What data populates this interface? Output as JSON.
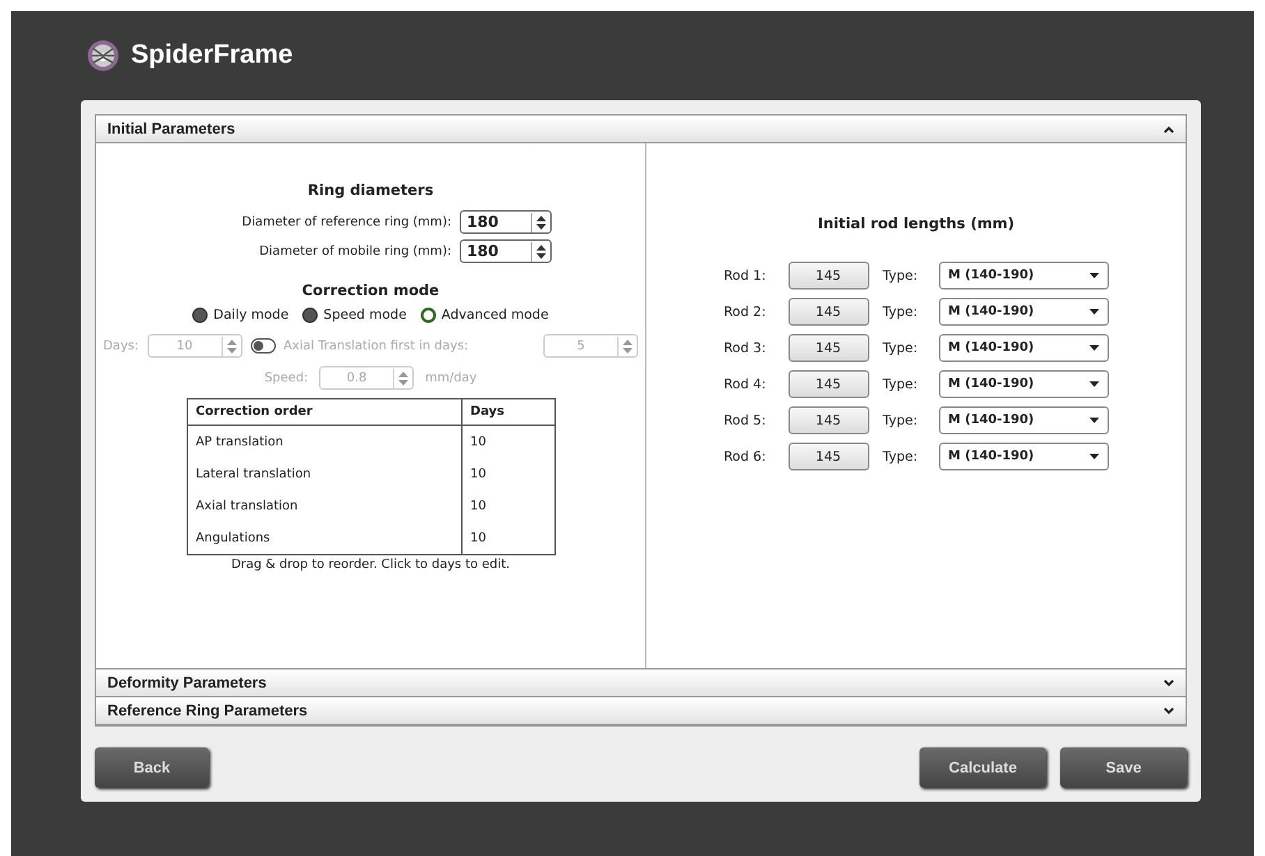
{
  "app": {
    "title": "SpiderFrame"
  },
  "sections": [
    {
      "title": "Initial Parameters",
      "expanded": true
    },
    {
      "title": "Deformity Parameters",
      "expanded": false
    },
    {
      "title": "Reference Ring Parameters",
      "expanded": false
    }
  ],
  "ring_diameters": {
    "heading": "Ring diameters",
    "fields": [
      {
        "label": "Diameter of reference ring (mm):",
        "value": "180"
      },
      {
        "label": "Diameter of mobile ring (mm):",
        "value": "180"
      }
    ]
  },
  "correction_mode": {
    "heading": "Correction mode",
    "options": [
      {
        "label": "Daily mode",
        "selected": false
      },
      {
        "label": "Speed mode",
        "selected": false
      },
      {
        "label": "Advanced mode",
        "selected": true
      }
    ],
    "days": {
      "label": "Days:",
      "value": "10",
      "disabled": true
    },
    "axial_first": {
      "label": "Axial Translation first in days:",
      "on": false,
      "value": "5",
      "disabled": true
    },
    "speed": {
      "label": "Speed:",
      "value": "0.8",
      "unit": "mm/day",
      "disabled": true
    }
  },
  "order_table": {
    "columns": [
      "Correction order",
      "Days"
    ],
    "rows": [
      [
        "AP translation",
        "10"
      ],
      [
        "Lateral translation",
        "10"
      ],
      [
        "Axial translation",
        "10"
      ],
      [
        "Angulations",
        "10"
      ]
    ],
    "hint": "Drag & drop to reorder. Click to days to edit."
  },
  "rods": {
    "heading": "Initial rod lengths (mm)",
    "items": [
      {
        "label": "Rod 1:",
        "value": "145",
        "type_label": "Type:",
        "type": "M (140-190)"
      },
      {
        "label": "Rod 2:",
        "value": "145",
        "type_label": "Type:",
        "type": "M (140-190)"
      },
      {
        "label": "Rod 3:",
        "value": "145",
        "type_label": "Type:",
        "type": "M (140-190)"
      },
      {
        "label": "Rod 4:",
        "value": "145",
        "type_label": "Type:",
        "type": "M (140-190)"
      },
      {
        "label": "Rod 5:",
        "value": "145",
        "type_label": "Type:",
        "type": "M (140-190)"
      },
      {
        "label": "Rod 6:",
        "value": "145",
        "type_label": "Type:",
        "type": "M (140-190)"
      }
    ]
  },
  "buttons": {
    "left": [
      "Back"
    ],
    "right": [
      "Calculate",
      "Save"
    ]
  }
}
